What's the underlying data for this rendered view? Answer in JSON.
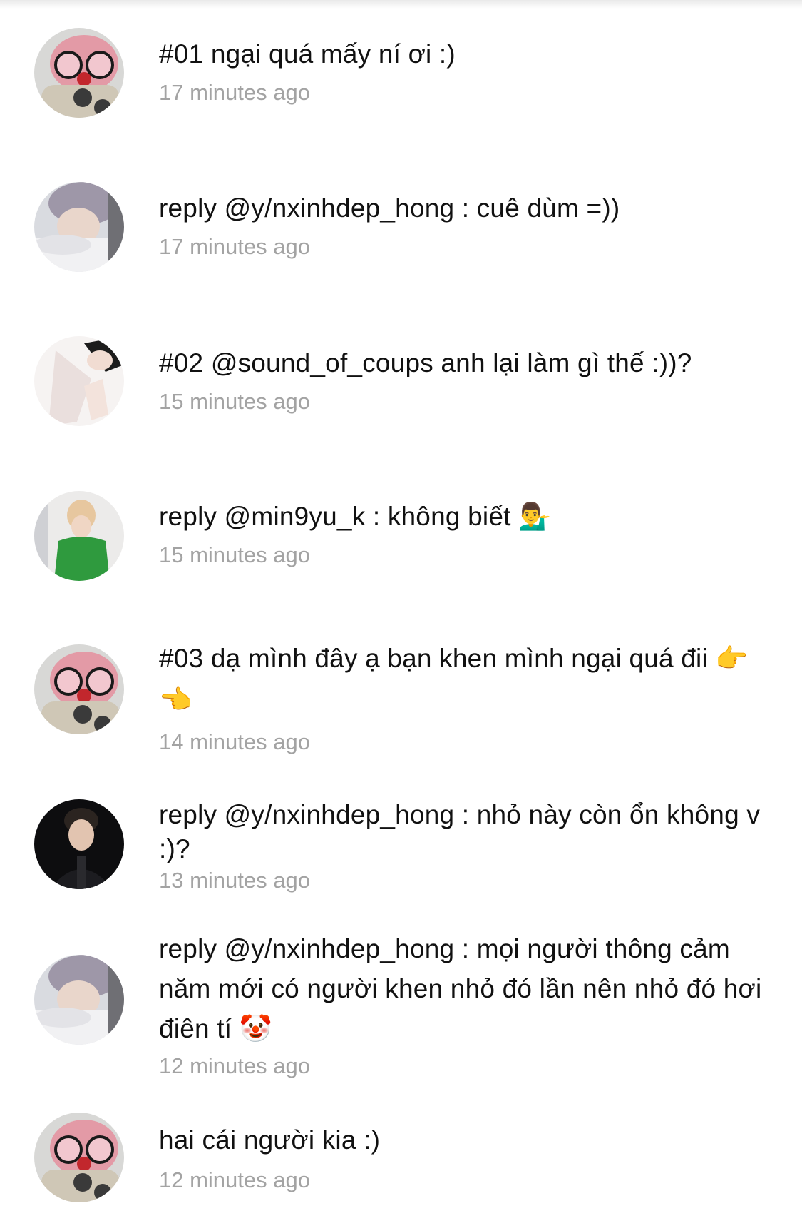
{
  "comments": [
    {
      "text": "#01 ngại quá mấy ní ơi :)",
      "time": "17 minutes ago",
      "avatar": "pink-bear-phone"
    },
    {
      "text": "reply @y/nxinhdep_hong : cuê dùm =))",
      "time": "17 minutes ago",
      "avatar": "sleeping-boy"
    },
    {
      "text": "#02 @sound_of_coups anh lại làm gì thế :))?",
      "time": "15 minutes ago",
      "avatar": "boy-hand-gesture"
    },
    {
      "text": "reply @min9yu_k : không biết 💁‍♂️",
      "time": "15 minutes ago",
      "avatar": "blond-green-shirt"
    },
    {
      "text": "#03 dạ mình đây ạ bạn khen mình ngại quá đii 👉👈",
      "time": "14 minutes ago",
      "avatar": "pink-bear-phone"
    },
    {
      "text": "reply @y/nxinhdep_hong : nhỏ này còn ổn không v :)?",
      "time": "13 minutes ago",
      "avatar": "dark-suit-man"
    },
    {
      "text": "reply @y/nxinhdep_hong : mọi người thông cảm năm mới có người khen nhỏ đó lần nên nhỏ đó hơi điên tí 🤡",
      "time": "12 minutes ago",
      "avatar": "sleeping-boy"
    },
    {
      "text": "hai cái người kia :)",
      "time": "12 minutes ago",
      "avatar": "pink-bear-phone"
    }
  ]
}
